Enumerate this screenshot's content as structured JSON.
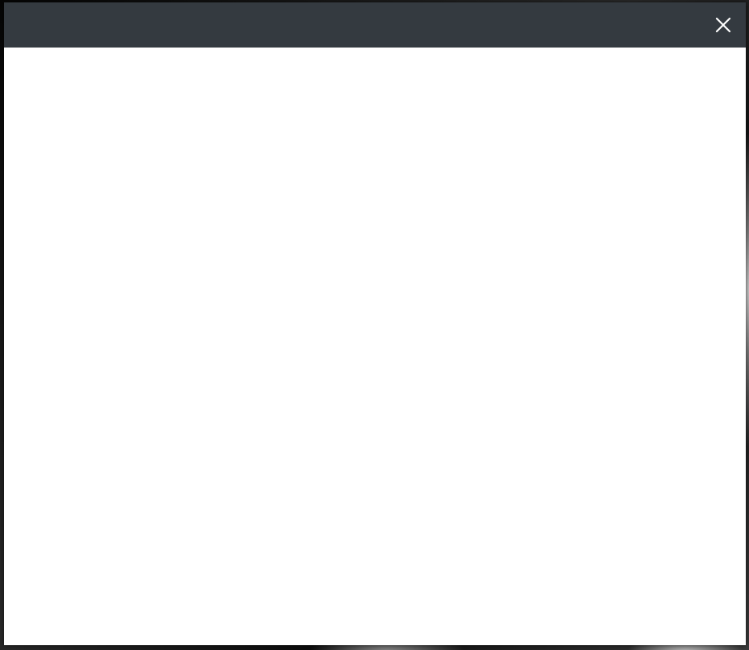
{
  "backdrop": {
    "description_icon": "photo-background"
  },
  "modal": {
    "header_color": "#343a40",
    "body_color": "#ffffff",
    "close_icon": "close-icon"
  }
}
